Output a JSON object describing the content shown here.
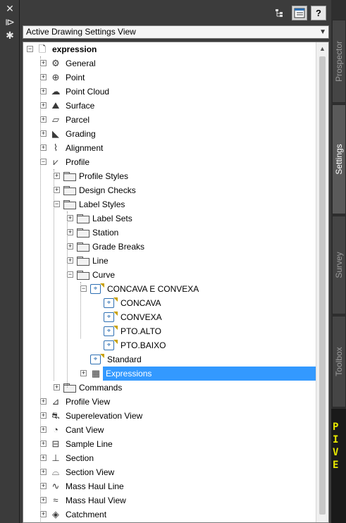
{
  "left_strip": {
    "icons": [
      "close-icon",
      "pin-icon",
      "properties-icon"
    ],
    "close_glyph": "✕",
    "pin_glyph": "⧐",
    "props_glyph": "✱"
  },
  "toolbar": {
    "buttons": [
      "tree-view-icon",
      "item-view-icon",
      "help-icon"
    ],
    "help_label": "?"
  },
  "view_select": {
    "value": "Active Drawing Settings View"
  },
  "tree": [
    {
      "level": 0,
      "label": "expression",
      "bold": true,
      "icon": "drawing-icon",
      "expander": "-"
    },
    {
      "level": 1,
      "label": "General",
      "icon": "general-icon",
      "expander": "+"
    },
    {
      "level": 1,
      "label": "Point",
      "icon": "point-icon",
      "expander": "+"
    },
    {
      "level": 1,
      "label": "Point Cloud",
      "icon": "point-cloud-icon",
      "expander": "+"
    },
    {
      "level": 1,
      "label": "Surface",
      "icon": "surface-icon",
      "expander": "+"
    },
    {
      "level": 1,
      "label": "Parcel",
      "icon": "parcel-icon",
      "expander": "+"
    },
    {
      "level": 1,
      "label": "Grading",
      "icon": "grading-icon",
      "expander": "+"
    },
    {
      "level": 1,
      "label": "Alignment",
      "icon": "alignment-icon",
      "expander": "+"
    },
    {
      "level": 1,
      "label": "Profile",
      "icon": "profile-icon",
      "expander": "-"
    },
    {
      "level": 2,
      "label": "Profile Styles",
      "icon": "folder-icon",
      "expander": "+"
    },
    {
      "level": 2,
      "label": "Design Checks",
      "icon": "folder-icon",
      "expander": "+"
    },
    {
      "level": 2,
      "label": "Label Styles",
      "icon": "folder-open-icon",
      "expander": "-"
    },
    {
      "level": 3,
      "label": "Label Sets",
      "icon": "folder-icon",
      "expander": "+"
    },
    {
      "level": 3,
      "label": "Station",
      "icon": "folder-icon",
      "expander": "+"
    },
    {
      "level": 3,
      "label": "Grade Breaks",
      "icon": "folder-icon",
      "expander": "+"
    },
    {
      "level": 3,
      "label": "Line",
      "icon": "folder-icon",
      "expander": "+"
    },
    {
      "level": 3,
      "label": "Curve",
      "icon": "folder-open-icon",
      "expander": "-"
    },
    {
      "level": 4,
      "label": "CONCAVA E CONVEXA",
      "icon": "label-style-icon",
      "expander": "-"
    },
    {
      "level": 5,
      "label": "CONCAVA",
      "icon": "label-style-icon",
      "expander": ""
    },
    {
      "level": 5,
      "label": "CONVEXA",
      "icon": "label-style-icon",
      "expander": ""
    },
    {
      "level": 5,
      "label": "PTO.ALTO",
      "icon": "label-style-icon",
      "expander": ""
    },
    {
      "level": 5,
      "label": "PTO.BAIXO",
      "icon": "label-style-icon",
      "expander": ""
    },
    {
      "level": 4,
      "label": "Standard",
      "icon": "label-style-icon",
      "expander": ""
    },
    {
      "level": 4,
      "label": "Expressions",
      "icon": "expressions-icon",
      "expander": "+",
      "selected": true
    },
    {
      "level": 2,
      "label": "Commands",
      "icon": "folder-icon",
      "expander": "+"
    },
    {
      "level": 1,
      "label": "Profile View",
      "icon": "profile-view-icon",
      "expander": "+"
    },
    {
      "level": 1,
      "label": "Superelevation View",
      "icon": "superelevation-view-icon",
      "expander": "+"
    },
    {
      "level": 1,
      "label": "Cant View",
      "icon": "cant-view-icon",
      "expander": "+"
    },
    {
      "level": 1,
      "label": "Sample Line",
      "icon": "sample-line-icon",
      "expander": "+"
    },
    {
      "level": 1,
      "label": "Section",
      "icon": "section-icon",
      "expander": "+"
    },
    {
      "level": 1,
      "label": "Section View",
      "icon": "section-view-icon",
      "expander": "+"
    },
    {
      "level": 1,
      "label": "Mass Haul Line",
      "icon": "mass-haul-line-icon",
      "expander": "+"
    },
    {
      "level": 1,
      "label": "Mass Haul View",
      "icon": "mass-haul-view-icon",
      "expander": "+"
    },
    {
      "level": 1,
      "label": "Catchment",
      "icon": "catchment-icon",
      "expander": "+"
    }
  ],
  "tabs": [
    {
      "label": "Prospector",
      "active": false
    },
    {
      "label": "Settings",
      "active": true
    },
    {
      "label": "Survey",
      "active": false
    },
    {
      "label": "Toolbox",
      "active": false
    }
  ],
  "drawing_glyphs": [
    "P",
    "I",
    "V",
    "E"
  ],
  "colors": {
    "selection": "#3399ff",
    "panel_bg": "#3c3c3c",
    "style_icon_blue": "#2d6fb3",
    "flag_yellow": "#c8a000",
    "drawing_yellow": "#e8e800"
  }
}
